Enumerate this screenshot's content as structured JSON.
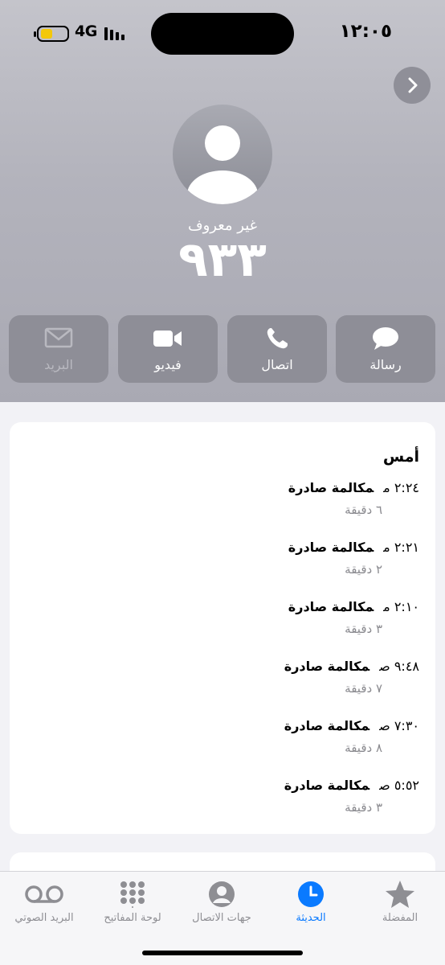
{
  "status_bar": {
    "time": "١٢:٠٥",
    "network": "4G",
    "battery_color": "#f3c80a"
  },
  "contact": {
    "label": "غير معروف",
    "number": "٩٣٣"
  },
  "actions": [
    {
      "label": "رسالة",
      "icon": "message-bubble-icon"
    },
    {
      "label": "اتصال",
      "icon": "phone-icon"
    },
    {
      "label": "فيديو",
      "icon": "video-camera-icon"
    },
    {
      "label": "البريد",
      "icon": "envelope-icon"
    }
  ],
  "history": {
    "title": "أمس",
    "calls": [
      {
        "time": "٢:٢٤ م",
        "type": "مكالمة صادرة",
        "duration": "٦ دقيقة"
      },
      {
        "time": "٢:٢١ م",
        "type": "مكالمة صادرة",
        "duration": "٢ دقيقة"
      },
      {
        "time": "٢:١٠ م",
        "type": "مكالمة صادرة",
        "duration": "٣ دقيقة"
      },
      {
        "time": "٩:٤٨ ص",
        "type": "مكالمة صادرة",
        "duration": "٧ دقيقة"
      },
      {
        "time": "٧:٣٠ ص",
        "type": "مكالمة صادرة",
        "duration": "٨ دقيقة"
      },
      {
        "time": "٥:٥٢ ص",
        "type": "مكالمة صادرة",
        "duration": "٣ دقيقة"
      }
    ]
  },
  "tabs": [
    {
      "label": "المفضلة",
      "icon": "star-icon",
      "active": false
    },
    {
      "label": "الحديثة",
      "icon": "clock-icon",
      "active": true
    },
    {
      "label": "جهات الاتصال",
      "icon": "person-icon",
      "active": false
    },
    {
      "label": "لوحة المفاتيح",
      "icon": "keypad-icon",
      "active": false
    },
    {
      "label": "البريد الصوتي",
      "icon": "voicemail-icon",
      "active": false
    }
  ],
  "colors": {
    "accent": "#0a7aff",
    "action_button": "#8e8e97",
    "secondary_text": "#8a8a8f"
  }
}
